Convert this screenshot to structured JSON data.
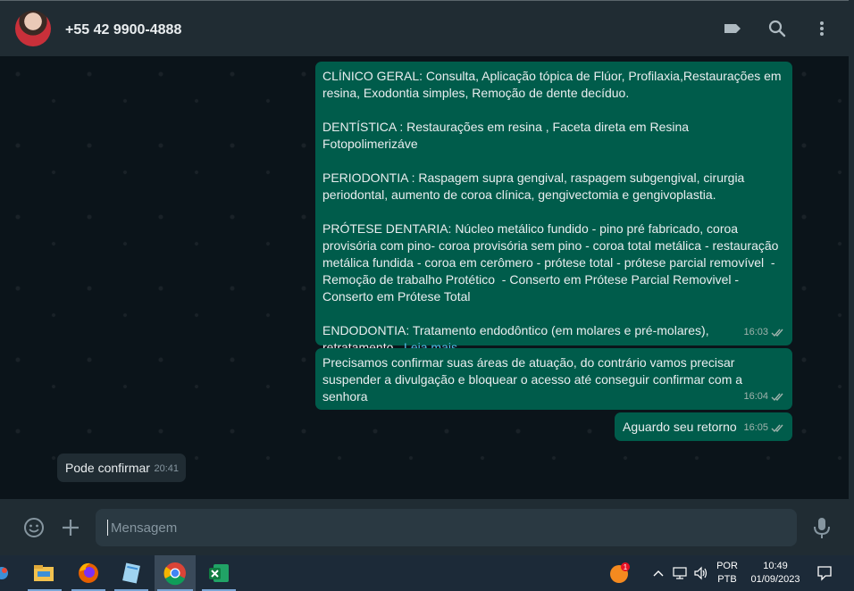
{
  "header": {
    "contact_name": "+55 42 9900-4888",
    "icons": [
      "label-icon",
      "search-icon",
      "menu-icon"
    ]
  },
  "messages": [
    {
      "direction": "outgoing",
      "text_parts": [
        "CLÍNICO GERAL: Consulta, Aplicação tópica de Flúor, Profilaxia,Restaurações em resina, Exodontia simples, Remoção de dente decíduo.",
        "DENTÍSTICA : Restaurações em resina , Faceta direta em Resina Fotopolimerizáve",
        "PERIODONTIA : Raspagem supra gengival, raspagem subgengival, cirurgia periodontal, aumento de coroa clínica, gengivectomia e gengivoplastia.",
        "PRÓTESE DENTARIA: Núcleo metálico fundido - pino pré fabricado, coroa provisória com pino- coroa provisória sem pino - coroa total metálica - restauração metálica fundida - coroa em cerômero - prótese total - prótese parcial removível  - Remoção de trabalho Protético  - Conserto em Prótese Parcial Removivel - Conserto em Prótese Total",
        "ENDODONTIA: Tratamento endodôntico (em molares e pré-molares), retratamento..."
      ],
      "read_more": "Leia mais",
      "time": "16:03"
    },
    {
      "direction": "outgoing",
      "text": "Precisamos confirmar suas áreas de atuação, do contrário vamos precisar suspender a divulgação e bloquear o acesso até conseguir confirmar com a senhora",
      "time": "16:04"
    },
    {
      "direction": "outgoing",
      "text": "Aguardo seu retorno",
      "time": "16:05"
    },
    {
      "direction": "incoming",
      "text": "Pode confirmar",
      "time": "20:41"
    }
  ],
  "composer": {
    "placeholder": "Mensagem",
    "icons": [
      "emoji-icon",
      "attach-plus-icon",
      "microphone-icon"
    ]
  },
  "taskbar": {
    "apps": [
      "file-explorer-icon",
      "firefox-icon",
      "notepad-icon",
      "chrome-icon",
      "excel-icon"
    ],
    "notification_badge": "1",
    "language_top": "POR",
    "language_bottom": "PTB",
    "time": "10:49",
    "date": "01/09/2023"
  },
  "colors": {
    "outgoing_bubble": "#005c4b",
    "incoming_bubble": "#202c33",
    "header_bg": "#202c33",
    "chat_bg": "#0b141a",
    "read_more": "#53bdeb",
    "taskbar_bg": "#1c2a38"
  }
}
